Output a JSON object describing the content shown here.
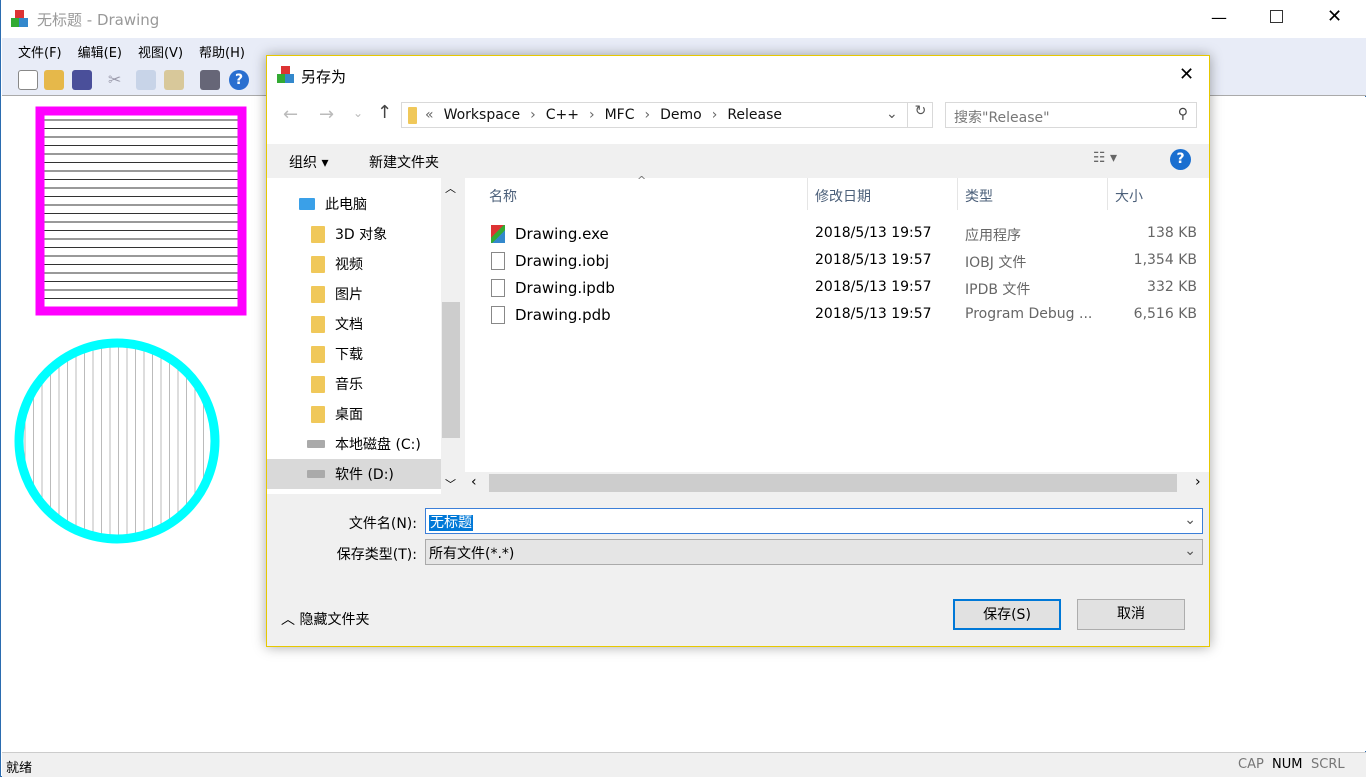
{
  "app": {
    "title": "无标题 - Drawing",
    "menu": [
      "文件(F)",
      "编辑(E)",
      "视图(V)",
      "帮助(H)"
    ],
    "toolbar": [
      "new-icon",
      "open-icon",
      "save-icon",
      "cut-icon",
      "copy-icon",
      "paste-icon",
      "print-icon",
      "help-icon"
    ],
    "status": {
      "text": "就绪",
      "indicators": [
        "CAP",
        "NUM",
        "SCRL"
      ]
    },
    "drawing": {
      "square_border_color": "#ff00ff",
      "square_line_color": "#333333",
      "circle_border_color": "#00ffff",
      "circle_line_color": "#bbbbbb"
    }
  },
  "dialog": {
    "title": "另存为",
    "path": [
      "Workspace",
      "C++",
      "MFC",
      "Demo",
      "Release"
    ],
    "search_placeholder": "搜索\"Release\"",
    "organize": "组织",
    "new_folder": "新建文件夹",
    "nav": [
      {
        "label": "此电脑",
        "icon": "computer-icon"
      },
      {
        "label": "3D 对象",
        "icon": "folder-icon"
      },
      {
        "label": "视频",
        "icon": "folder-icon"
      },
      {
        "label": "图片",
        "icon": "folder-icon"
      },
      {
        "label": "文档",
        "icon": "folder-icon"
      },
      {
        "label": "下载",
        "icon": "folder-icon"
      },
      {
        "label": "音乐",
        "icon": "folder-icon"
      },
      {
        "label": "桌面",
        "icon": "folder-icon"
      },
      {
        "label": "本地磁盘 (C:)",
        "icon": "drive-icon"
      },
      {
        "label": "软件 (D:)",
        "icon": "drive-icon",
        "selected": true
      }
    ],
    "columns": [
      "名称",
      "修改日期",
      "类型",
      "大小"
    ],
    "files": [
      {
        "name": "Drawing.exe",
        "date": "2018/5/13 19:57",
        "type": "应用程序",
        "size": "138 KB"
      },
      {
        "name": "Drawing.iobj",
        "date": "2018/5/13 19:57",
        "type": "IOBJ 文件",
        "size": "1,354 KB"
      },
      {
        "name": "Drawing.ipdb",
        "date": "2018/5/13 19:57",
        "type": "IPDB 文件",
        "size": "332 KB"
      },
      {
        "name": "Drawing.pdb",
        "date": "2018/5/13 19:57",
        "type": "Program Debug ...",
        "size": "6,516 KB"
      }
    ],
    "filename_label": "文件名(N):",
    "filename_value": "无标题",
    "filetype_label": "保存类型(T):",
    "filetype_value": "所有文件(*.*)",
    "hide_folders": "隐藏文件夹",
    "save": "保存(S)",
    "cancel": "取消"
  }
}
